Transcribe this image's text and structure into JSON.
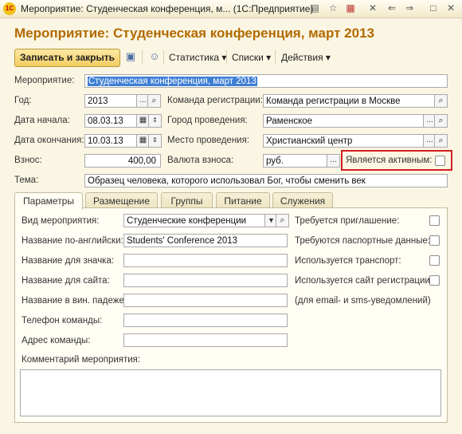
{
  "window": {
    "logo": "1С",
    "title": "Мероприятие: Студенческая конференция, м... (1С:Предприятие)"
  },
  "form": {
    "title": "Мероприятие: Студенческая конференция, март 2013"
  },
  "toolbar": {
    "save_close": "Записать и закрыть",
    "statistics": "Статистика",
    "lists": "Списки",
    "actions": "Действия"
  },
  "fields": {
    "event_label": "Мероприятие:",
    "event_value": "Студенческая конференция, март 2013",
    "year_label": "Год:",
    "year_value": "2013",
    "start_label": "Дата начала:",
    "start_value": "08.03.13",
    "end_label": "Дата окончания:",
    "end_value": "10.03.13",
    "fee_label": "Взнос:",
    "fee_value": "400,00",
    "topic_label": "Тема:",
    "topic_value": "Образец человека, которого использовал Бог, чтобы сменить век",
    "team_label": "Команда регистрации:",
    "team_value": "Команда регистрации в Москве",
    "city_label": "Город проведения:",
    "city_value": "Раменское",
    "place_label": "Место проведения:",
    "place_value": "Христианский центр",
    "currency_label": "Валюта взноса:",
    "currency_value": "руб.",
    "active_label": "Является активным:",
    "active_checked": false
  },
  "tabs": [
    "Параметры",
    "Размещение",
    "Группы",
    "Питание",
    "Служения"
  ],
  "params": {
    "kind_label": "Вид мероприятия:",
    "kind_value": "Студенческие конференции",
    "name_en_label": "Название по-английски:",
    "name_en_value": "Students' Conference 2013",
    "badge_label": "Название для значка:",
    "site_label": "Название для сайта:",
    "accusative_label": "Название в вин. падеже:",
    "phone_label": "Телефон команды:",
    "address_label": "Адрес команды:",
    "comment_label": "Комментарий мероприятия:",
    "invite_label": "Требуется приглашение:",
    "passport_label": "Требуются паспортные данные:",
    "transport_label": "Используется транспорт:",
    "regsite_label": "Используется сайт регистрации:",
    "note": "(для email- и sms-уведомлений)"
  }
}
